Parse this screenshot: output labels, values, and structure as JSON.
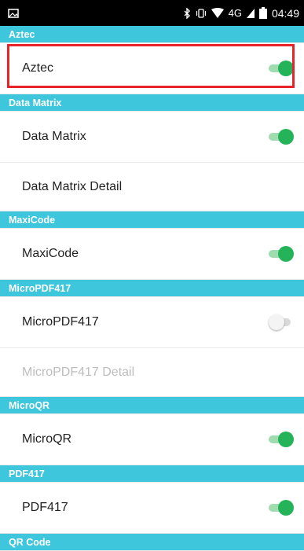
{
  "status_bar": {
    "notification_icon": "image-icon",
    "bluetooth_icon": "bluetooth-icon",
    "vibrate_icon": "vibrate-icon",
    "wifi_icon": "wifi-icon",
    "network": "4G",
    "signal_icon": "signal-icon",
    "battery_icon": "battery-icon",
    "time": "04:49"
  },
  "colors": {
    "section_header": "#3ec6dc",
    "toggle_on": "#25b35a",
    "highlight": "#e8232a"
  },
  "sections": [
    {
      "header": "Aztec",
      "rows": [
        {
          "label": "Aztec",
          "toggle": "on",
          "highlighted": true
        }
      ]
    },
    {
      "header": "Data Matrix",
      "rows": [
        {
          "label": "Data Matrix",
          "toggle": "on"
        },
        {
          "label": "Data Matrix Detail"
        }
      ]
    },
    {
      "header": "MaxiCode",
      "rows": [
        {
          "label": "MaxiCode",
          "toggle": "on"
        }
      ]
    },
    {
      "header": "MicroPDF417",
      "rows": [
        {
          "label": "MicroPDF417",
          "toggle": "off"
        },
        {
          "label": "MicroPDF417 Detail",
          "disabled": true
        }
      ]
    },
    {
      "header": "MicroQR",
      "rows": [
        {
          "label": "MicroQR",
          "toggle": "on"
        }
      ]
    },
    {
      "header": "PDF417",
      "rows": [
        {
          "label": "PDF417",
          "toggle": "on"
        }
      ]
    },
    {
      "header": "QR Code",
      "rows": []
    }
  ]
}
